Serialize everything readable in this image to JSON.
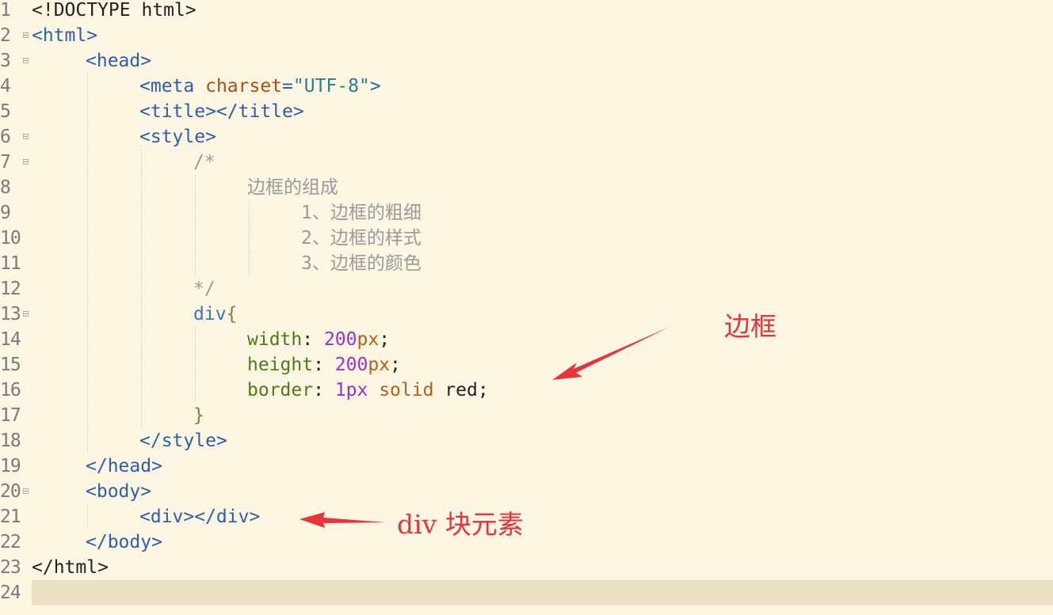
{
  "editor": {
    "current_line": 24,
    "lines": [
      {
        "n": "1",
        "fold": false,
        "indent": 0,
        "tokens": [
          {
            "t": "<!DOCTYPE html>",
            "c": "plain"
          }
        ]
      },
      {
        "n": "2",
        "fold": true,
        "indent": 0,
        "tokens": [
          {
            "t": "<html>",
            "c": "tag"
          }
        ]
      },
      {
        "n": "3",
        "fold": true,
        "indent": 1,
        "tokens": [
          {
            "t": "<head>",
            "c": "tag"
          }
        ]
      },
      {
        "n": "4",
        "fold": false,
        "indent": 2,
        "tokens": [
          {
            "t": "<meta ",
            "c": "tag"
          },
          {
            "t": "charset",
            "c": "attr"
          },
          {
            "t": "=",
            "c": "tag"
          },
          {
            "t": "\"UTF-8\"",
            "c": "str"
          },
          {
            "t": ">",
            "c": "tag"
          }
        ]
      },
      {
        "n": "5",
        "fold": false,
        "indent": 2,
        "tokens": [
          {
            "t": "<title></title>",
            "c": "tag"
          }
        ]
      },
      {
        "n": "6",
        "fold": true,
        "indent": 2,
        "tokens": [
          {
            "t": "<style>",
            "c": "tag"
          }
        ]
      },
      {
        "n": "7",
        "fold": true,
        "indent": 3,
        "tokens": [
          {
            "t": "/*",
            "c": "cmt"
          }
        ]
      },
      {
        "n": "8",
        "fold": false,
        "indent": 4,
        "tokens": [
          {
            "t": "边框的组成",
            "c": "cmt"
          }
        ]
      },
      {
        "n": "9",
        "fold": false,
        "indent": 5,
        "tokens": [
          {
            "t": "1、边框的粗细",
            "c": "cmt"
          }
        ]
      },
      {
        "n": "10",
        "fold": false,
        "indent": 5,
        "tokens": [
          {
            "t": "2、边框的样式",
            "c": "cmt"
          }
        ]
      },
      {
        "n": "11",
        "fold": false,
        "indent": 5,
        "tokens": [
          {
            "t": "3、边框的颜色",
            "c": "cmt"
          }
        ]
      },
      {
        "n": "12",
        "fold": false,
        "indent": 3,
        "tokens": [
          {
            "t": "*/",
            "c": "cmt"
          }
        ]
      },
      {
        "n": "13",
        "fold": true,
        "indent": 3,
        "tokens": [
          {
            "t": "div",
            "c": "sel"
          },
          {
            "t": "{",
            "c": "brace"
          }
        ]
      },
      {
        "n": "14",
        "fold": false,
        "indent": 4,
        "tokens": [
          {
            "t": "width",
            "c": "prop"
          },
          {
            "t": ": ",
            "c": "plain"
          },
          {
            "t": "200",
            "c": "num"
          },
          {
            "t": "px",
            "c": "kw"
          },
          {
            "t": ";",
            "c": "plain"
          }
        ]
      },
      {
        "n": "15",
        "fold": false,
        "indent": 4,
        "tokens": [
          {
            "t": "height",
            "c": "prop"
          },
          {
            "t": ": ",
            "c": "plain"
          },
          {
            "t": "200",
            "c": "num"
          },
          {
            "t": "px",
            "c": "kw"
          },
          {
            "t": ";",
            "c": "plain"
          }
        ]
      },
      {
        "n": "16",
        "fold": false,
        "indent": 4,
        "tokens": [
          {
            "t": "border",
            "c": "prop"
          },
          {
            "t": ": ",
            "c": "plain"
          },
          {
            "t": "1px",
            "c": "num"
          },
          {
            "t": " ",
            "c": "plain"
          },
          {
            "t": "solid",
            "c": "kw"
          },
          {
            "t": " red;",
            "c": "plain"
          }
        ]
      },
      {
        "n": "17",
        "fold": false,
        "indent": 3,
        "tokens": [
          {
            "t": "}",
            "c": "brace"
          }
        ]
      },
      {
        "n": "18",
        "fold": false,
        "indent": 2,
        "tokens": [
          {
            "t": "</style>",
            "c": "tag"
          }
        ]
      },
      {
        "n": "19",
        "fold": false,
        "indent": 1,
        "tokens": [
          {
            "t": "</head>",
            "c": "tag"
          }
        ]
      },
      {
        "n": "20",
        "fold": true,
        "indent": 1,
        "tokens": [
          {
            "t": "<body>",
            "c": "tag"
          }
        ]
      },
      {
        "n": "21",
        "fold": false,
        "indent": 2,
        "tokens": [
          {
            "t": "<div></div>",
            "c": "tag"
          }
        ]
      },
      {
        "n": "22",
        "fold": false,
        "indent": 1,
        "tokens": [
          {
            "t": "</body>",
            "c": "tag"
          }
        ]
      },
      {
        "n": "23",
        "fold": false,
        "indent": 0,
        "tokens": [
          {
            "t": "</html>",
            "c": "plain"
          }
        ]
      },
      {
        "n": "24",
        "fold": false,
        "indent": 0,
        "tokens": []
      }
    ]
  },
  "annotations": {
    "border_label": "边框",
    "div_label": "div 块元素",
    "color": "#e8333a"
  }
}
